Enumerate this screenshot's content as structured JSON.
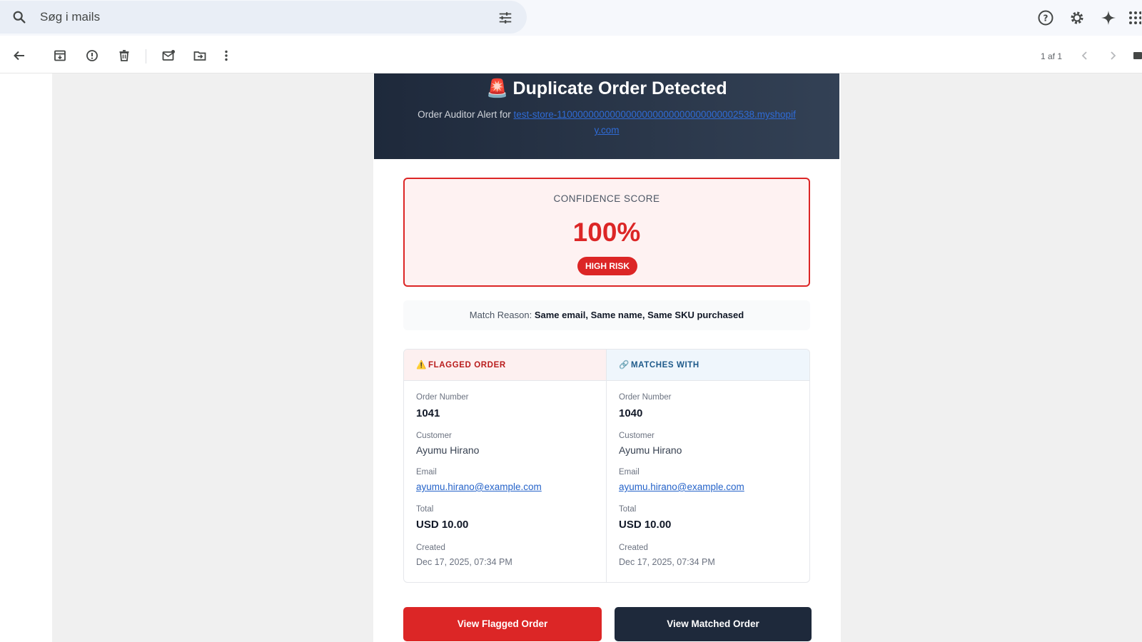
{
  "search": {
    "placeholder": "Søg i mails",
    "icon": "search-icon",
    "filter_icon": "tune-icon"
  },
  "header_icons": [
    "help-icon",
    "settings-icon",
    "gemini-icon",
    "apps-icon"
  ],
  "toolbar": {
    "icons": [
      "back-icon",
      "archive-icon",
      "report-spam-icon",
      "delete-icon",
      "mark-unread-icon",
      "move-to-icon",
      "more-icon"
    ],
    "pager": "1 af 1"
  },
  "email": {
    "title_emoji": "🚨",
    "title": "Duplicate Order Detected",
    "subtitle_prefix": "Order Auditor Alert for",
    "store_link": "test-store-1100000000000000000000000000000002538.myshopify.com",
    "confidence": {
      "label": "CONFIDENCE SCORE",
      "value": "100%",
      "percent": 100,
      "badge": "HIGH RISK"
    },
    "match_reason": {
      "label": "Match Reason:",
      "value": "Same email, Same name, Same SKU purchased"
    },
    "flagged": {
      "heading_icon": "⚠️",
      "heading": "FLAGGED ORDER",
      "order_number_label": "Order Number",
      "order_number": "1041",
      "customer_label": "Customer",
      "customer": "Ayumu Hirano",
      "email_label": "Email",
      "email": "ayumu.hirano@example.com",
      "total_label": "Total",
      "total": "USD 10.00",
      "created_label": "Created",
      "created": "Dec 17, 2025, 07:34 PM"
    },
    "matched": {
      "heading_icon": "🔗",
      "heading": "MATCHES WITH",
      "order_number_label": "Order Number",
      "order_number": "1040",
      "customer_label": "Customer",
      "customer": "Ayumu Hirano",
      "email_label": "Email",
      "email": "ayumu.hirano@example.com",
      "total_label": "Total",
      "total": "USD 10.00",
      "created_label": "Created",
      "created": "Dec 17, 2025, 07:34 PM"
    },
    "buttons": {
      "flagged": "View Flagged Order",
      "matched": "View Matched Order"
    }
  },
  "colors": {
    "danger": "#dc2626",
    "dark": "#1e293b",
    "link": "#2563c9"
  }
}
